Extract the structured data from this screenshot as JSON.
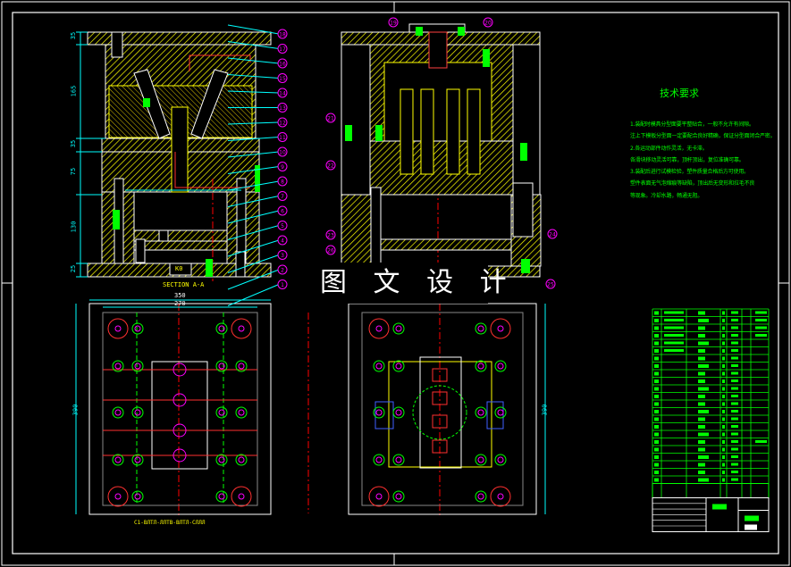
{
  "watermark": "图 文 设 计",
  "section_label": "SECTION A-A",
  "plan_view_label": "C1-ВЛТЛ-ЛЛТВ-ВЛТЛ-СЛЛЛ",
  "part_label": "K0",
  "tech_requirements": {
    "title": "技术要求",
    "lines": [
      "1.装配时模具分型面要平整贴合，一般不允许有间隙。",
      "注上下模板分型面一定要配合良好精确，保证分型面闭合严密。",
      "2.各运动部件动作灵活，无卡滞。",
      "各滑块移动灵活可靠，顶杆顶出，复位准确可靠。",
      "3.装配后进行试模检验，塑件质量合格后方可使用。",
      "塑件表面无气泡缩痕等缺陷，顶出后无变形和拉毛不良",
      "等现象。冷却水路，畅通无阻。"
    ]
  },
  "dimensions": {
    "section_heights": [
      "35",
      "165",
      "35",
      "75",
      "130",
      "25"
    ],
    "plan_width_outer": "350",
    "plan_width_inner": "270",
    "plan_height_left": "390",
    "plan_height_right": "390"
  },
  "balloons_left": [
    "18",
    "17",
    "16",
    "15",
    "14",
    "13",
    "12",
    "11",
    "10",
    "9",
    "8",
    "7",
    "6",
    "5",
    "4",
    "3",
    "2",
    "1"
  ],
  "balloons_right": [
    "19",
    "20",
    "21",
    "22",
    "23",
    "24",
    "25",
    "26"
  ],
  "colors": {
    "background": "#000000",
    "outline": "#ffffff",
    "hatch": "#ffff00",
    "dimension": "#00ffff",
    "balloon": "#ff00ff",
    "table": "#00ff00",
    "centerline": "#ff0000"
  }
}
